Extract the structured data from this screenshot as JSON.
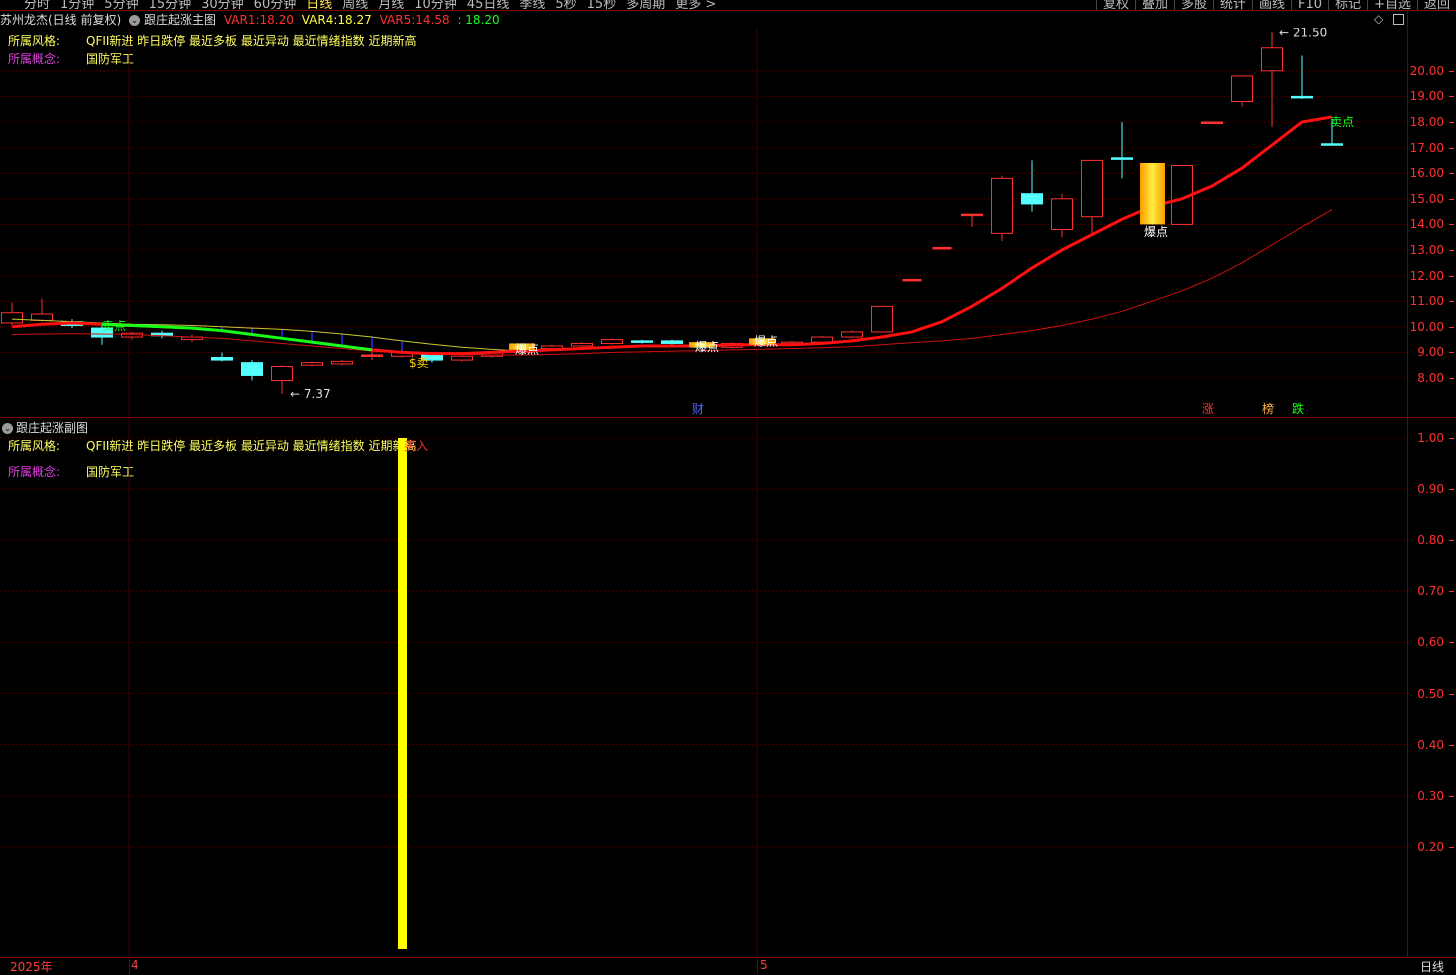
{
  "toolbar": {
    "tabs": [
      "分时",
      "1分钟",
      "5分钟",
      "15分钟",
      "30分钟",
      "60分钟",
      "日线",
      "周线",
      "月线",
      "10分钟",
      "45日线",
      "季线",
      "5秒",
      "15秒",
      "多周期",
      "更多 >"
    ],
    "active_tab": "日线",
    "right_buttons": [
      "复权",
      "叠加",
      "多股",
      "统计",
      "画线",
      "F10",
      "标记",
      "+自选",
      "返回"
    ]
  },
  "title": {
    "stock": "苏州龙杰(日线 前复权)",
    "indicator": "跟庄起涨主图",
    "var1_label": "VAR1:",
    "var1_value": "18.20",
    "var4_label": "VAR4:",
    "var4_value": "18.27",
    "var5_label": "VAR5:",
    "var5_value": "14.58",
    "extra": ": 18.20"
  },
  "info": {
    "style_label": "所属风格:",
    "style_value": "QFII新进 昨日跌停 最近多板 最近异动 最近情绪指数 近期新高",
    "concept_label": "所属概念:",
    "concept_value": "国防军工"
  },
  "sub": {
    "title": "跟庄起涨副图",
    "buy_mark": "买入"
  },
  "annotations": {
    "high": "21.50",
    "low": "7.37",
    "sell_point": "卖点",
    "explode": "爆点",
    "buy_sell": "$卖",
    "markers": [
      "财",
      "涨",
      "榜",
      "跌"
    ]
  },
  "dates": {
    "year": "2025年",
    "m4": "4",
    "m5": "5"
  },
  "period_label": "日线",
  "colors": {
    "up": "#ff3030",
    "down": "#54ffff",
    "ma_red": "#ff1010",
    "ma_green": "#18ff18",
    "ma_thin": "#d01010",
    "yellow": "#ffff00"
  },
  "chart_data": [
    {
      "type": "candlestick",
      "title": "跟庄起涨主图",
      "ylim": [
        7.0,
        22.5
      ],
      "yticks": [
        8,
        9,
        10,
        11,
        12,
        13,
        14,
        15,
        16,
        17,
        18,
        19,
        20
      ],
      "x_labels": [
        "2025年",
        "4",
        "5"
      ],
      "candles": [
        {
          "o": 10.15,
          "c": 10.55,
          "h": 10.95,
          "l": 10.05,
          "up": true
        },
        {
          "o": 10.25,
          "c": 10.5,
          "h": 11.1,
          "l": 10.2,
          "up": true
        },
        {
          "o": 10.2,
          "c": 10.05,
          "h": 10.3,
          "l": 9.95,
          "up": false
        },
        {
          "o": 9.95,
          "c": 9.6,
          "h": 10.15,
          "l": 9.3,
          "up": false
        },
        {
          "o": 9.6,
          "c": 9.75,
          "h": 9.8,
          "l": 9.5,
          "up": true
        },
        {
          "o": 9.75,
          "c": 9.65,
          "h": 9.85,
          "l": 9.55,
          "up": false
        },
        {
          "o": 9.5,
          "c": 9.6,
          "h": 9.7,
          "l": 9.4,
          "up": true
        },
        {
          "o": 8.8,
          "c": 8.7,
          "h": 9.0,
          "l": 8.65,
          "up": false
        },
        {
          "o": 8.6,
          "c": 8.1,
          "h": 8.7,
          "l": 7.9,
          "up": false
        },
        {
          "o": 7.9,
          "c": 8.45,
          "h": 8.5,
          "l": 7.37,
          "up": true
        },
        {
          "o": 8.5,
          "c": 8.6,
          "h": 8.65,
          "l": 8.45,
          "up": true
        },
        {
          "o": 8.55,
          "c": 8.65,
          "h": 8.7,
          "l": 8.5,
          "up": true
        },
        {
          "o": 8.9,
          "c": 8.9,
          "h": 9.1,
          "l": 8.7,
          "up": true
        },
        {
          "o": 8.85,
          "c": 9.0,
          "h": 9.1,
          "l": 8.8,
          "up": true
        },
        {
          "o": 8.95,
          "c": 8.7,
          "h": 9.0,
          "l": 8.6,
          "up": false
        },
        {
          "o": 8.7,
          "c": 8.85,
          "h": 8.9,
          "l": 8.65,
          "up": true
        },
        {
          "o": 8.85,
          "c": 9.0,
          "h": 9.05,
          "l": 8.8,
          "up": true
        },
        {
          "o": 9.0,
          "c": 9.15,
          "h": 9.2,
          "l": 8.95,
          "up": true
        },
        {
          "o": 9.15,
          "c": 9.25,
          "h": 9.3,
          "l": 9.1,
          "up": true
        },
        {
          "o": 9.25,
          "c": 9.35,
          "h": 9.4,
          "l": 9.2,
          "up": true
        },
        {
          "o": 9.35,
          "c": 9.5,
          "h": 9.55,
          "l": 9.3,
          "up": true
        },
        {
          "o": 9.45,
          "c": 9.4,
          "h": 9.5,
          "l": 9.35,
          "up": false
        },
        {
          "o": 9.45,
          "c": 9.35,
          "h": 9.5,
          "l": 9.3,
          "up": false
        },
        {
          "o": 9.3,
          "c": 9.2,
          "h": 9.35,
          "l": 9.15,
          "up": false
        },
        {
          "o": 9.2,
          "c": 9.35,
          "h": 9.4,
          "l": 9.15,
          "up": true
        },
        {
          "o": 9.3,
          "c": 9.4,
          "h": 9.45,
          "l": 9.25,
          "up": true
        },
        {
          "o": 9.35,
          "c": 9.4,
          "h": 9.45,
          "l": 9.3,
          "up": true
        },
        {
          "o": 9.4,
          "c": 9.6,
          "h": 9.65,
          "l": 9.35,
          "up": true
        },
        {
          "o": 9.6,
          "c": 9.8,
          "h": 9.85,
          "l": 9.55,
          "up": true
        },
        {
          "o": 9.8,
          "c": 10.8,
          "h": 10.8,
          "l": 9.8,
          "up": true
        },
        {
          "o": 11.85,
          "c": 11.85,
          "h": 11.85,
          "l": 11.85,
          "up": true
        },
        {
          "o": 13.1,
          "c": 13.1,
          "h": 13.1,
          "l": 13.1,
          "up": true
        },
        {
          "o": 14.4,
          "c": 14.4,
          "h": 14.4,
          "l": 13.9,
          "up": true
        },
        {
          "o": 13.65,
          "c": 15.8,
          "h": 15.9,
          "l": 13.35,
          "up": true
        },
        {
          "o": 15.2,
          "c": 14.8,
          "h": 16.5,
          "l": 14.5,
          "up": false
        },
        {
          "o": 13.8,
          "c": 15.0,
          "h": 15.2,
          "l": 13.5,
          "up": true
        },
        {
          "o": 14.3,
          "c": 16.5,
          "h": 16.5,
          "l": 13.6,
          "up": true
        },
        {
          "o": 16.6,
          "c": 16.6,
          "h": 18.0,
          "l": 15.8,
          "up": false
        },
        {
          "o": 14.95,
          "c": 14.95,
          "h": 15.6,
          "l": 14.8,
          "up": false
        },
        {
          "o": 14.0,
          "c": 16.3,
          "h": 16.3,
          "l": 14.0,
          "up": true
        },
        {
          "o": 18.0,
          "c": 18.0,
          "h": 18.0,
          "l": 18.0,
          "up": true
        },
        {
          "o": 18.8,
          "c": 19.8,
          "h": 19.8,
          "l": 18.6,
          "up": true
        },
        {
          "o": 20.0,
          "c": 20.9,
          "h": 21.5,
          "l": 17.8,
          "up": true
        },
        {
          "o": 19.0,
          "c": 18.95,
          "h": 20.6,
          "l": 18.9,
          "up": false
        },
        {
          "o": 17.15,
          "c": 17.1,
          "h": 18.1,
          "l": 17.1,
          "up": false
        }
      ],
      "series": [
        {
          "values": [
            10.0,
            10.1,
            10.15,
            10.1,
            10.05,
            10.0,
            9.95,
            9.85,
            9.7,
            9.55,
            9.4,
            9.25,
            9.1,
            9.0,
            8.95,
            8.95,
            9.0,
            9.05,
            9.1,
            9.15,
            9.2,
            9.25,
            9.25,
            9.25,
            9.3,
            9.3,
            9.3,
            9.35,
            9.45,
            9.6,
            9.8,
            10.2,
            10.8,
            11.5,
            12.3,
            13.0,
            13.6,
            14.2,
            14.7,
            15.0,
            15.5,
            16.2,
            17.1,
            18.0,
            18.2
          ]
        },
        {
          "values": [
            9.7,
            9.72,
            9.73,
            9.72,
            9.7,
            9.65,
            9.6,
            9.55,
            9.45,
            9.35,
            9.25,
            9.15,
            9.05,
            8.98,
            8.95,
            8.92,
            8.9,
            8.9,
            8.92,
            8.95,
            9.0,
            9.02,
            9.05,
            9.07,
            9.1,
            9.12,
            9.15,
            9.18,
            9.22,
            9.3,
            9.38,
            9.45,
            9.55,
            9.7,
            9.85,
            10.05,
            10.3,
            10.6,
            11.0,
            11.4,
            11.9,
            12.5,
            13.2,
            13.9,
            14.58
          ]
        },
        {
          "values": [
            10.3,
            10.25,
            10.2,
            10.15,
            10.1,
            10.08,
            10.05,
            10.0,
            9.95,
            9.9,
            9.82,
            9.72,
            9.6,
            9.45,
            9.32,
            9.2,
            9.12,
            9.05
          ]
        }
      ]
    },
    {
      "type": "bar",
      "title": "跟庄起涨副图",
      "ylim": [
        0,
        1.05
      ],
      "yticks": [
        0.2,
        0.3,
        0.4,
        0.5,
        0.6,
        0.7,
        0.8,
        0.9,
        1.0
      ],
      "bars": [
        {
          "index": 13,
          "value": 1.0
        }
      ]
    }
  ]
}
